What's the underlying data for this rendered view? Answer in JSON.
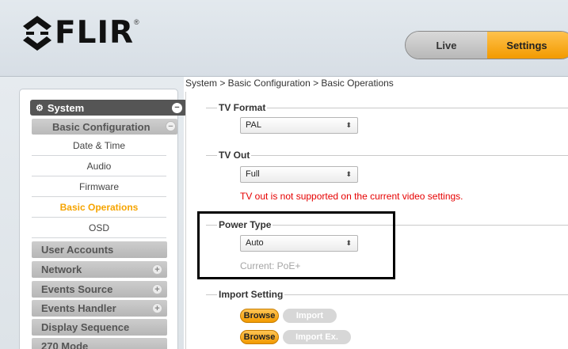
{
  "header": {
    "logo_text": "FLIR",
    "logo_mark": "®",
    "live_label": "Live",
    "settings_label": "Settings"
  },
  "breadcrumb": "System > Basic Configuration > Basic Operations",
  "sidebar": {
    "system_label": "System",
    "basic_config_label": "Basic Configuration",
    "items": [
      {
        "label": "Date & Time"
      },
      {
        "label": "Audio"
      },
      {
        "label": "Firmware"
      },
      {
        "label": "Basic Operations"
      },
      {
        "label": "OSD"
      }
    ],
    "groups": [
      {
        "label": "User Accounts"
      },
      {
        "label": "Network"
      },
      {
        "label": "Events Source"
      },
      {
        "label": "Events Handler"
      },
      {
        "label": "Display Sequence"
      },
      {
        "label": "270 Mode"
      }
    ]
  },
  "content": {
    "tv_format": {
      "title": "TV Format",
      "value": "PAL"
    },
    "tv_out": {
      "title": "TV Out",
      "value": "Full",
      "warning": "TV out is not supported on the current video settings."
    },
    "power_type": {
      "title": "Power Type",
      "value": "Auto",
      "current": "Current: PoE+"
    },
    "import_setting": {
      "title": "Import Setting",
      "browse_label": "Browse",
      "import_label": "Import",
      "import_ex_label": "Import Ex."
    }
  },
  "colors": {
    "accent": "#f29a00",
    "warning": "#e60000",
    "highlight_border": "#000000"
  }
}
